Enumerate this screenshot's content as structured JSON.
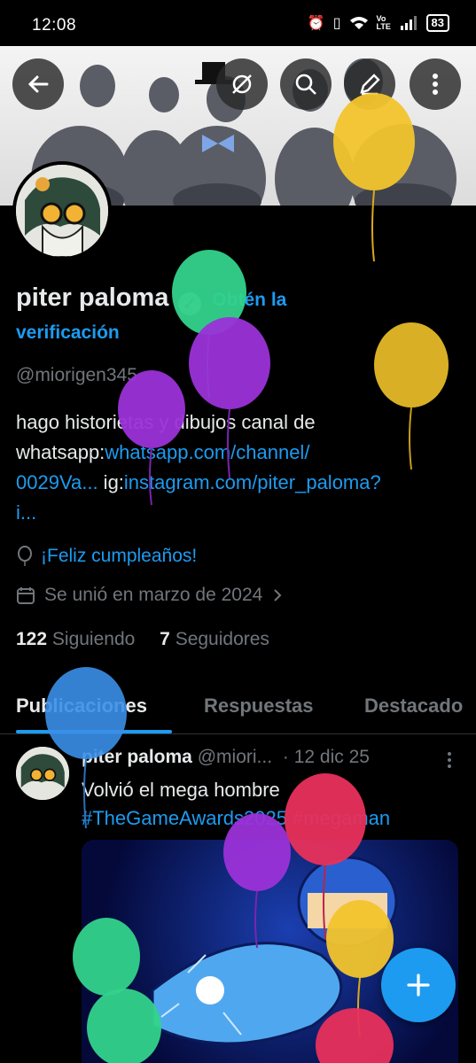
{
  "status_bar": {
    "time": "12:08",
    "network": "Vo LTE",
    "battery": "83"
  },
  "profile": {
    "name": "piter paloma",
    "verify_line1": "Obtén la",
    "verify_line2": "verificación",
    "handle": "@miorigen345",
    "bio_text": "hago historietas y dibujos canal de",
    "bio_prefix2": "whatsapp:",
    "bio_link1_a": "whatsapp.com/channel/",
    "bio_link1_b": "0029Va...",
    "bio_ig": " ig:",
    "bio_link2_a": "instagram.com/piter_paloma?",
    "bio_link2_b": "i...",
    "birthday": "¡Feliz cumpleaños!",
    "joined": "Se unió en marzo de 2024",
    "following_count": "122",
    "following_label": "Siguiendo",
    "followers_count": "7",
    "followers_label": "Seguidores"
  },
  "tabs": [
    "Publicaciones",
    "Respuestas",
    "Destacado"
  ],
  "post": {
    "author": "piter paloma",
    "handle": "@miori...",
    "date": "· 12 dic 25",
    "text": "Volvió el mega hombre",
    "hashtags": "#TheGameAwards2025 #megaman"
  },
  "icons": [
    "back-arrow-icon",
    "no-sync-icon",
    "search-icon",
    "edit-icon",
    "more-icon",
    "balloon-icon",
    "calendar-icon",
    "chevron-right-icon",
    "plus-icon"
  ],
  "colors": {
    "accent": "#1d9bf0",
    "background": "#000000",
    "text": "#e7e9ea",
    "muted": "#71767b"
  }
}
